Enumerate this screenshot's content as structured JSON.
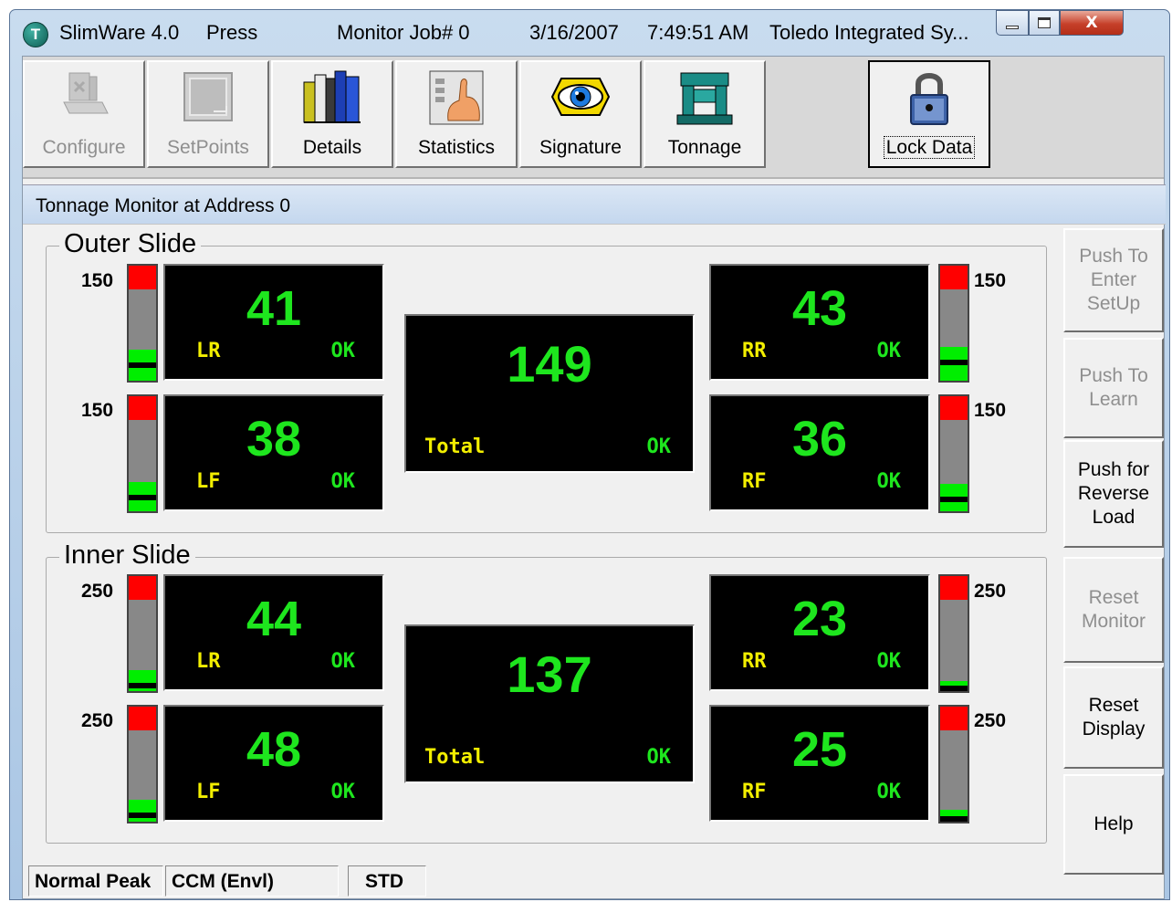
{
  "titlebar": {
    "app": "SlimWare 4.0",
    "machine": "Press",
    "job": "Monitor Job# 0",
    "date": "3/16/2007",
    "time": "7:49:51 AM",
    "company": "Toledo Integrated Sy...",
    "buttons": [
      "minimize",
      "maximize",
      "close"
    ],
    "close_glyph": "X"
  },
  "toolbar": [
    {
      "label": "Configure",
      "icon": "configure-icon",
      "enabled": false
    },
    {
      "label": "SetPoints",
      "icon": "setpoints-icon",
      "enabled": false
    },
    {
      "label": "Details",
      "icon": "books-icon",
      "enabled": true
    },
    {
      "label": "Statistics",
      "icon": "statistics-hand-icon",
      "enabled": true
    },
    {
      "label": "Signature",
      "icon": "eye-icon",
      "enabled": true
    },
    {
      "label": "Tonnage",
      "icon": "press-icon",
      "enabled": true
    },
    {
      "label": "Lock Data",
      "icon": "padlock-icon",
      "enabled": true
    }
  ],
  "panel_title": "Tonnage Monitor at Address 0",
  "outer": {
    "title": "Outer Slide",
    "corners": {
      "lr": {
        "name": "LR",
        "value": "41",
        "status": "OK",
        "scale": "150",
        "fill": 0.27
      },
      "lf": {
        "name": "LF",
        "value": "38",
        "status": "OK",
        "scale": "150",
        "fill": 0.25
      },
      "rr": {
        "name": "RR",
        "value": "43",
        "status": "OK",
        "scale": "150",
        "fill": 0.29
      },
      "rf": {
        "name": "RF",
        "value": "36",
        "status": "OK",
        "scale": "150",
        "fill": 0.24
      }
    },
    "total": {
      "label": "Total",
      "value": "149",
      "status": "OK"
    }
  },
  "inner": {
    "title": "Inner Slide",
    "corners": {
      "lr": {
        "name": "LR",
        "value": "44",
        "status": "OK",
        "scale": "250",
        "fill": 0.18
      },
      "lf": {
        "name": "LF",
        "value": "48",
        "status": "OK",
        "scale": "250",
        "fill": 0.19
      },
      "rr": {
        "name": "RR",
        "value": "23",
        "status": "OK",
        "scale": "250",
        "fill": 0.09
      },
      "rf": {
        "name": "RF",
        "value": "25",
        "status": "OK",
        "scale": "250",
        "fill": 0.1
      }
    },
    "total": {
      "label": "Total",
      "value": "137",
      "status": "OK"
    }
  },
  "side_buttons": [
    {
      "label": "Push To\nEnter\nSetUp",
      "enabled": false
    },
    {
      "label": "Push To\nLearn",
      "enabled": false
    },
    {
      "label": "Push for\nReverse\nLoad",
      "enabled": true
    },
    {
      "label": "Reset\nMonitor",
      "enabled": false
    },
    {
      "label": "Reset\nDisplay",
      "enabled": true
    },
    {
      "label": "Help",
      "enabled": true
    }
  ],
  "status": [
    "Normal Peak",
    "CCM (Envl)",
    "STD"
  ],
  "colors": {
    "value_green": "#1ee61e",
    "label_yellow": "#f2ee00",
    "alarm_red": "#ff0000",
    "bar_green": "#00ee00"
  }
}
